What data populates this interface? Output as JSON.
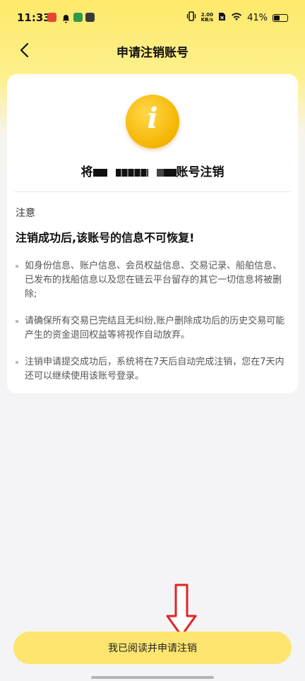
{
  "status_bar": {
    "time": "11:33",
    "net_speed_value": "2.00",
    "net_speed_unit": "KB/s",
    "battery_percent": "41%"
  },
  "nav": {
    "title": "申请注销账号"
  },
  "card": {
    "account_prefix": "将",
    "account_suffix": "账号注销",
    "notice_label": "注意",
    "warning": "注销成功后,该账号的信息不可恢复!",
    "items": [
      "如身份信息、账户信息、会员权益信息、交易记录、船舶信息、已发布的找船信息以及您在链云平台留存的其它一切信息将被删除;",
      "请确保所有交易已完结且无纠纷,账户删除成功后的历史交易可能产生的资金退回权益等将视作自动放弃。",
      "注销申请提交成功后，系统将在7天后自动完成注销，您在7天内还可以继续使用该账号登录。"
    ]
  },
  "footer": {
    "confirm_label": "我已阅读并申请注销"
  },
  "colors": {
    "brand_yellow": "#fde570",
    "icon_yellow": "#f5b400",
    "arrow_red": "#e52222"
  }
}
